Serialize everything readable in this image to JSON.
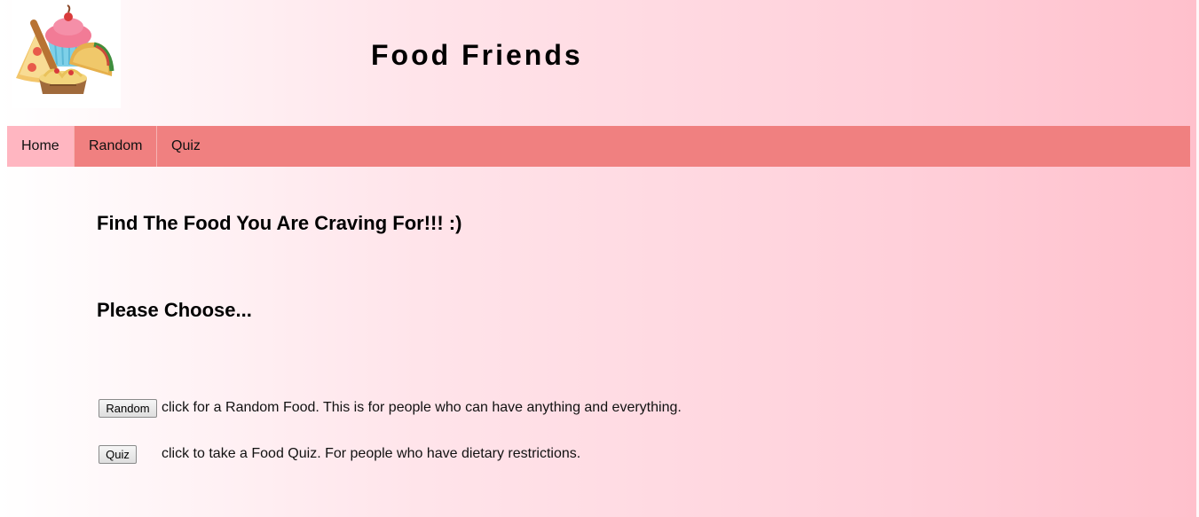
{
  "header": {
    "logo_icon": "food-collage-logo-icon",
    "title": "Food Friends"
  },
  "nav": {
    "items": [
      {
        "label": "Home",
        "active": true
      },
      {
        "label": "Random",
        "active": false
      },
      {
        "label": "Quiz",
        "active": false
      }
    ]
  },
  "main": {
    "heading": "Find The Food You Are Craving For!!! :)",
    "subheading": "Please Choose...",
    "options": [
      {
        "button_label": "Random",
        "description": "click for a Random Food. This is for people who can have anything and everything."
      },
      {
        "button_label": "Quiz",
        "description": "click to take a Food Quiz. For people who have dietary restrictions."
      }
    ]
  },
  "colors": {
    "nav_bg": "#f08080",
    "nav_active_bg": "#ffb6c1",
    "page_gradient_end": "#ffc0cc"
  }
}
